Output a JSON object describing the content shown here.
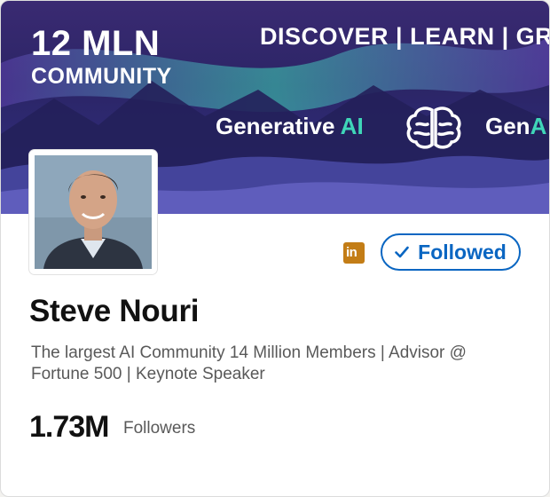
{
  "banner": {
    "headline_number": "12 MLN",
    "headline_word": "COMMUNITY",
    "tagline": "DISCOVER | LEARN | GR",
    "topic_prefix": "Generative ",
    "topic_suffix": "AI",
    "topic2_prefix": "Gen",
    "topic2_suffix": "A",
    "accent_color": "#3fd6b8"
  },
  "profile": {
    "name": "Steve Nouri",
    "headline": "The largest AI Community 14 Million Members | Advisor @ Fortune 500 | Keynote Speaker",
    "followers_count": "1.73M",
    "followers_label": "Followers",
    "platform_icon": "linkedin-icon",
    "platform_icon_text": "in"
  },
  "actions": {
    "follow_label": "Followed",
    "follow_icon": "check-icon",
    "brand_color": "#0a66c2"
  }
}
